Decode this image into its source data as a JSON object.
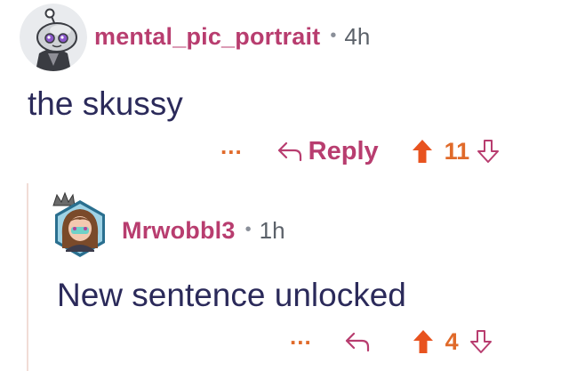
{
  "comments": [
    {
      "username": "mental_pic_portrait",
      "separator": "•",
      "time": "4h",
      "body": "the skussy",
      "more_label": "...",
      "reply_label": "Reply",
      "score": "11"
    },
    {
      "username": "Mrwobbl3",
      "separator": "•",
      "time": "1h",
      "body": "New sentence unlocked",
      "more_label": "...",
      "score": "4"
    }
  ],
  "colors": {
    "username": "#b83d6f",
    "accent": "#e06a2a",
    "body_text": "#2b2a5a",
    "thread_line": "#f1dcd6"
  },
  "icons": {
    "avatar_1": "snoo-avatar-icon",
    "avatar_2": "anime-girl-avatar-icon",
    "reply": "reply-arrow-icon",
    "upvote": "upvote-arrow-icon",
    "downvote": "downvote-arrow-icon",
    "more": "more-options-icon"
  }
}
